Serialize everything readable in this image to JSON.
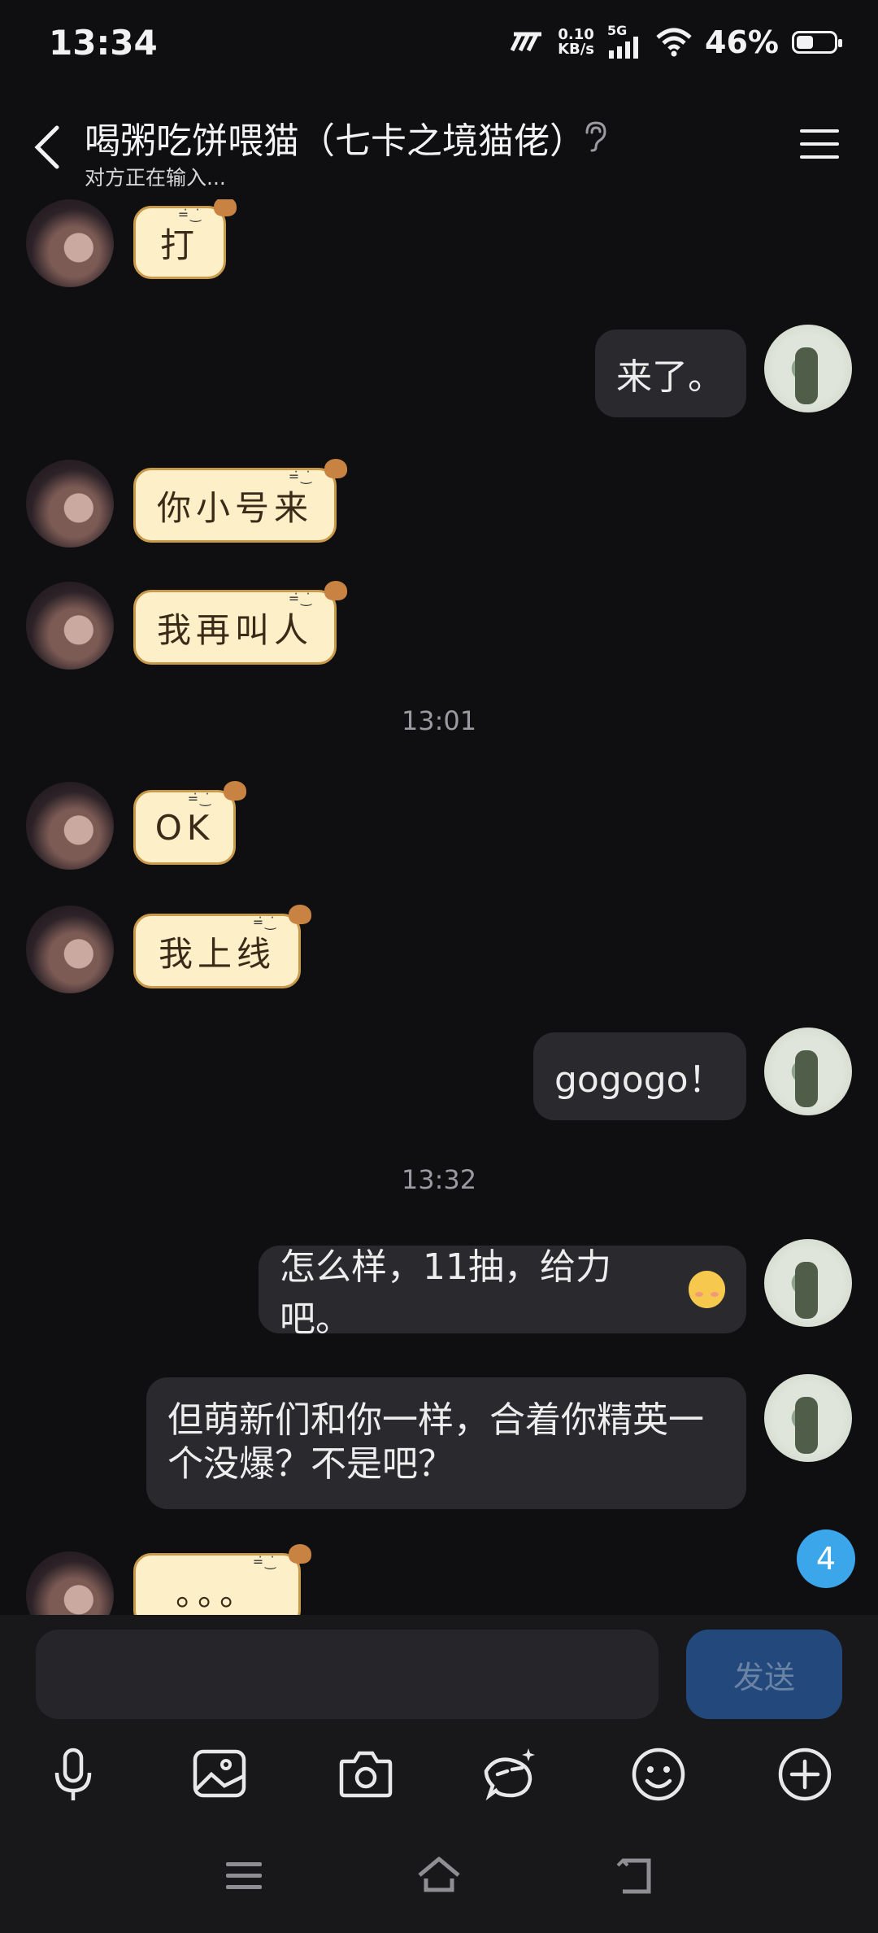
{
  "status_bar": {
    "time": "13:34",
    "net_speed_value": "0.10",
    "net_speed_unit": "KB/s",
    "network": "5G",
    "battery_percent": "46%",
    "battery_level": 0.46
  },
  "header": {
    "title": "喝粥吃饼喂猫（七卡之境猫佬）",
    "subtitle": "对方正在输入..."
  },
  "messages": [
    {
      "side": "left",
      "type": "sticker",
      "text": "打"
    },
    {
      "side": "right",
      "type": "text",
      "text": "来了。"
    },
    {
      "side": "left",
      "type": "sticker",
      "text": "你小号来"
    },
    {
      "side": "left",
      "type": "sticker",
      "text": "我再叫人"
    },
    {
      "type": "timestamp",
      "text": "13:01"
    },
    {
      "side": "left",
      "type": "sticker",
      "text": "OK"
    },
    {
      "side": "left",
      "type": "sticker",
      "text": "我上线"
    },
    {
      "side": "right",
      "type": "text",
      "text": "gogogo！"
    },
    {
      "type": "timestamp",
      "text": "13:32"
    },
    {
      "side": "right",
      "type": "text",
      "text": "怎么样，11抽，给力吧。"
    },
    {
      "side": "right",
      "type": "text",
      "text": "但萌新们和你一样，合着你精英一个没爆？不是吧？"
    },
    {
      "side": "left",
      "type": "sticker",
      "text": "。。。"
    }
  ],
  "unread_count": "4",
  "composer": {
    "placeholder": "",
    "send_label": "发送"
  },
  "toolbar_icons": [
    "microphone-icon",
    "image-icon",
    "camera-icon",
    "sticker-icon",
    "emoji-icon",
    "plus-icon"
  ],
  "colors": {
    "background": "#0f0f12",
    "bubble": "#2a2a2e",
    "sticker_fill": "#fdefc8",
    "send_button": "#22487c",
    "badge": "#3ba7ea"
  }
}
